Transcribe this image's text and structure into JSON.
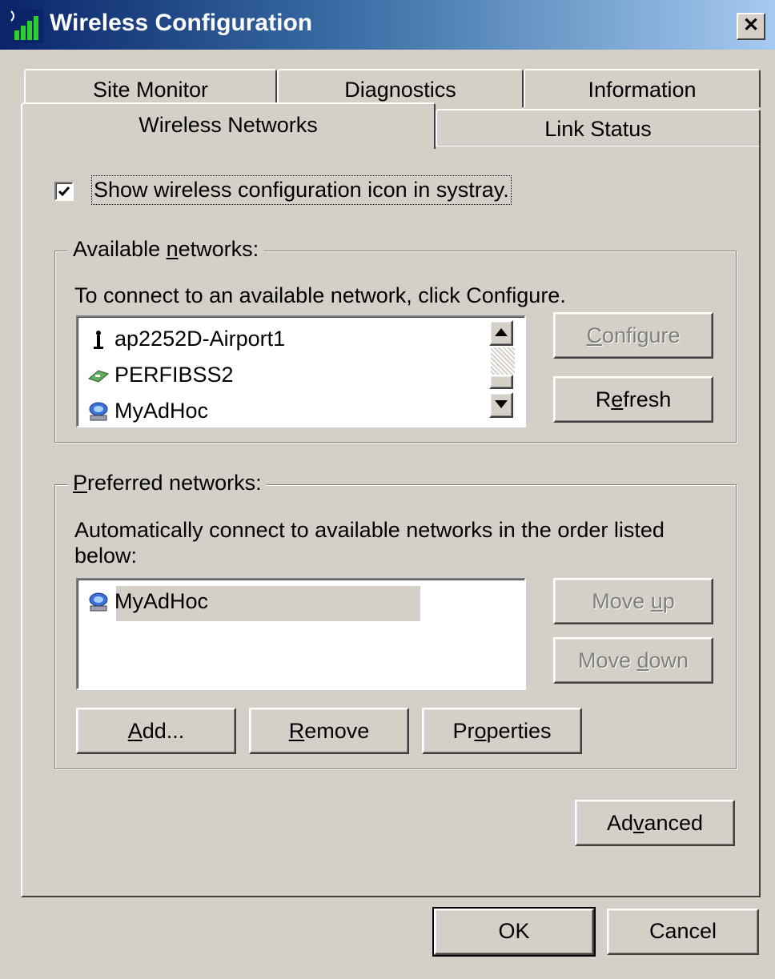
{
  "window": {
    "title": "Wireless Configuration"
  },
  "tabs": {
    "back_row": [
      "Site Monitor",
      "Diagnostics",
      "Information"
    ],
    "front_row": [
      "Wireless Networks",
      "Link Status"
    ],
    "active": "Wireless Networks"
  },
  "systray": {
    "label": "Show wireless configuration icon in systray.",
    "checked": true
  },
  "available": {
    "legend_pre": "Available ",
    "legend_u": "n",
    "legend_post": "etworks:",
    "instruction": "To connect to an available network, click Configure.",
    "networks": [
      {
        "name": "ap2252D-Airport1",
        "icon": "access-point-icon"
      },
      {
        "name": "PERFIBSS2",
        "icon": "network-card-icon"
      },
      {
        "name": "MyAdHoc",
        "icon": "adhoc-computers-icon"
      }
    ],
    "configure": {
      "u": "C",
      "rest": "onfigure",
      "enabled": false
    },
    "refresh": {
      "pre": "R",
      "u": "e",
      "post": "fresh",
      "enabled": true
    }
  },
  "preferred": {
    "legend_u": "P",
    "legend_post": "referred networks:",
    "instruction": "Automatically connect to available networks in the order listed below:",
    "networks": [
      {
        "name": "MyAdHoc",
        "icon": "adhoc-computers-icon",
        "selected": true
      }
    ],
    "move_up": {
      "pre": "Move ",
      "u": "u",
      "post": "p",
      "enabled": false
    },
    "move_down": {
      "pre": "Move ",
      "u": "d",
      "post": "own",
      "enabled": false
    },
    "add": {
      "u": "A",
      "post": "dd..."
    },
    "remove": {
      "u": "R",
      "post": "emove"
    },
    "properties": {
      "pre": "Pr",
      "u": "o",
      "post": "perties"
    }
  },
  "advanced": {
    "pre": "Ad",
    "u": "v",
    "post": "anced"
  },
  "footer": {
    "ok": "OK",
    "cancel": "Cancel"
  }
}
